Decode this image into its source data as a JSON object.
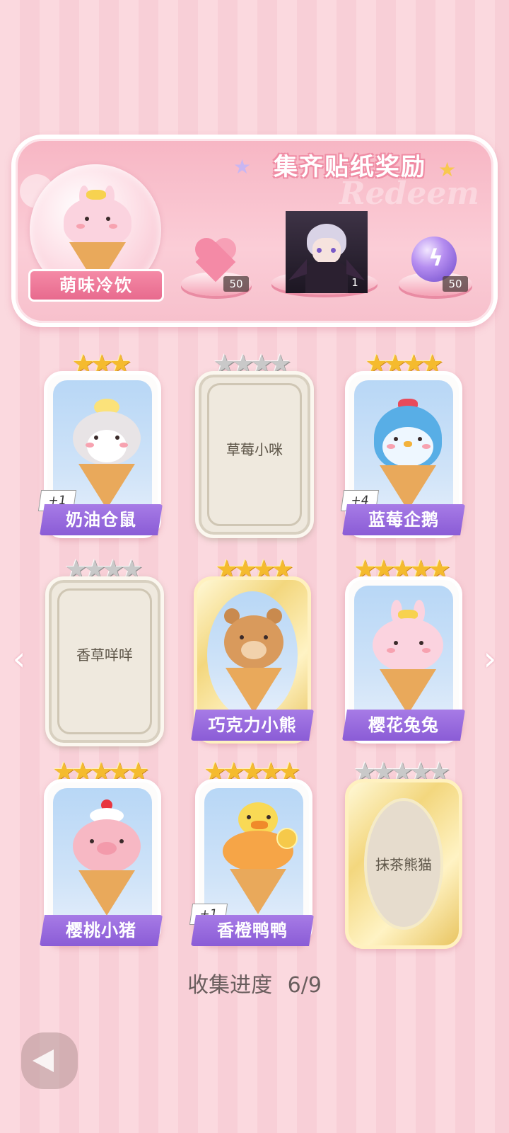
{
  "banner": {
    "title": "集齐贴纸奖励",
    "watermark": "Redeem",
    "set_name": "萌味冷饮",
    "rewards": [
      {
        "icon": "pink-heart-gem-icon",
        "count": "50"
      },
      {
        "icon": "character-portrait",
        "count": "1"
      },
      {
        "icon": "purple-energy-orb-icon",
        "count": "50"
      }
    ]
  },
  "cards": [
    {
      "name": "奶油仓鼠",
      "stars": 3,
      "max_stars": 3,
      "collected": true,
      "plus": "+1",
      "bg": "#b8d7f6"
    },
    {
      "name": "草莓小咪",
      "stars": 0,
      "max_stars": 4,
      "collected": false
    },
    {
      "name": "蓝莓企鹅",
      "stars": 4,
      "max_stars": 4,
      "collected": true,
      "plus": "+4",
      "bg": "#b8d7f6"
    },
    {
      "name": "香草咩咩",
      "stars": 0,
      "max_stars": 4,
      "collected": false
    },
    {
      "name": "巧克力小熊",
      "stars": 4,
      "max_stars": 4,
      "collected": true,
      "gold": true
    },
    {
      "name": "樱花兔兔",
      "stars": 5,
      "max_stars": 5,
      "collected": true
    },
    {
      "name": "樱桃小猪",
      "stars": 5,
      "max_stars": 5,
      "collected": true
    },
    {
      "name": "香橙鸭鸭",
      "stars": 5,
      "max_stars": 5,
      "collected": true,
      "plus": "+1"
    },
    {
      "name": "抹茶熊猫",
      "stars": 0,
      "max_stars": 5,
      "collected": false,
      "gold": true
    }
  ],
  "progress": {
    "label": "收集进度",
    "value": "6/9"
  },
  "colors": {
    "accent": "#8a5cd6",
    "star": "#f5bb2e",
    "pink": "#f48aa6"
  }
}
